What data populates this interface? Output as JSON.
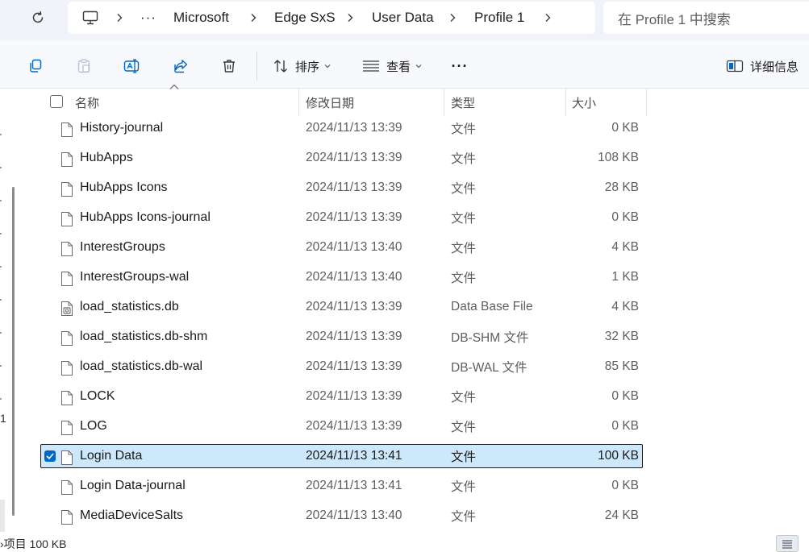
{
  "address": {
    "crumbs": [
      "Microsoft",
      "Edge SxS",
      "User Data",
      "Profile 1"
    ],
    "ellipsis": "···",
    "search_placeholder": "在 Profile 1 中搜索"
  },
  "toolbar": {
    "sort_label": "排序",
    "view_label": "查看",
    "more_label": "···",
    "details_label": "详细信息"
  },
  "columns": {
    "name": "名称",
    "modified": "修改日期",
    "type": "类型",
    "size": "大小"
  },
  "files": [
    {
      "name": "History-journal",
      "modified": "2024/11/13 13:39",
      "type": "文件",
      "size": "0 KB",
      "icon": "file-icon"
    },
    {
      "name": "HubApps",
      "modified": "2024/11/13 13:39",
      "type": "文件",
      "size": "108 KB",
      "icon": "file-icon"
    },
    {
      "name": "HubApps Icons",
      "modified": "2024/11/13 13:39",
      "type": "文件",
      "size": "28 KB",
      "icon": "file-icon"
    },
    {
      "name": "HubApps Icons-journal",
      "modified": "2024/11/13 13:39",
      "type": "文件",
      "size": "0 KB",
      "icon": "file-icon"
    },
    {
      "name": "InterestGroups",
      "modified": "2024/11/13 13:40",
      "type": "文件",
      "size": "4 KB",
      "icon": "file-icon"
    },
    {
      "name": "InterestGroups-wal",
      "modified": "2024/11/13 13:40",
      "type": "文件",
      "size": "1 KB",
      "icon": "file-icon"
    },
    {
      "name": "load_statistics.db",
      "modified": "2024/11/13 13:39",
      "type": "Data Base File",
      "size": "4 KB",
      "icon": "database-file-icon"
    },
    {
      "name": "load_statistics.db-shm",
      "modified": "2024/11/13 13:39",
      "type": "DB-SHM 文件",
      "size": "32 KB",
      "icon": "file-icon"
    },
    {
      "name": "load_statistics.db-wal",
      "modified": "2024/11/13 13:39",
      "type": "DB-WAL 文件",
      "size": "85 KB",
      "icon": "file-icon"
    },
    {
      "name": "LOCK",
      "modified": "2024/11/13 13:39",
      "type": "文件",
      "size": "0 KB",
      "icon": "file-icon"
    },
    {
      "name": "LOG",
      "modified": "2024/11/13 13:39",
      "type": "文件",
      "size": "0 KB",
      "icon": "file-icon"
    },
    {
      "name": "Login Data",
      "modified": "2024/11/13 13:41",
      "type": "文件",
      "size": "100 KB",
      "icon": "file-icon",
      "selected": true
    },
    {
      "name": "Login Data-journal",
      "modified": "2024/11/13 13:41",
      "type": "文件",
      "size": "0 KB",
      "icon": "file-icon"
    },
    {
      "name": "MediaDeviceSalts",
      "modified": "2024/11/13 13:40",
      "type": "文件",
      "size": "24 KB",
      "icon": "file-icon"
    }
  ],
  "nav": {
    "partial_digit": "1"
  },
  "status": {
    "text": "›项目  100 KB"
  },
  "colors": {
    "selection": "#cde8fb",
    "accent": "#0067c0",
    "chrome": "#f0f3f9"
  }
}
